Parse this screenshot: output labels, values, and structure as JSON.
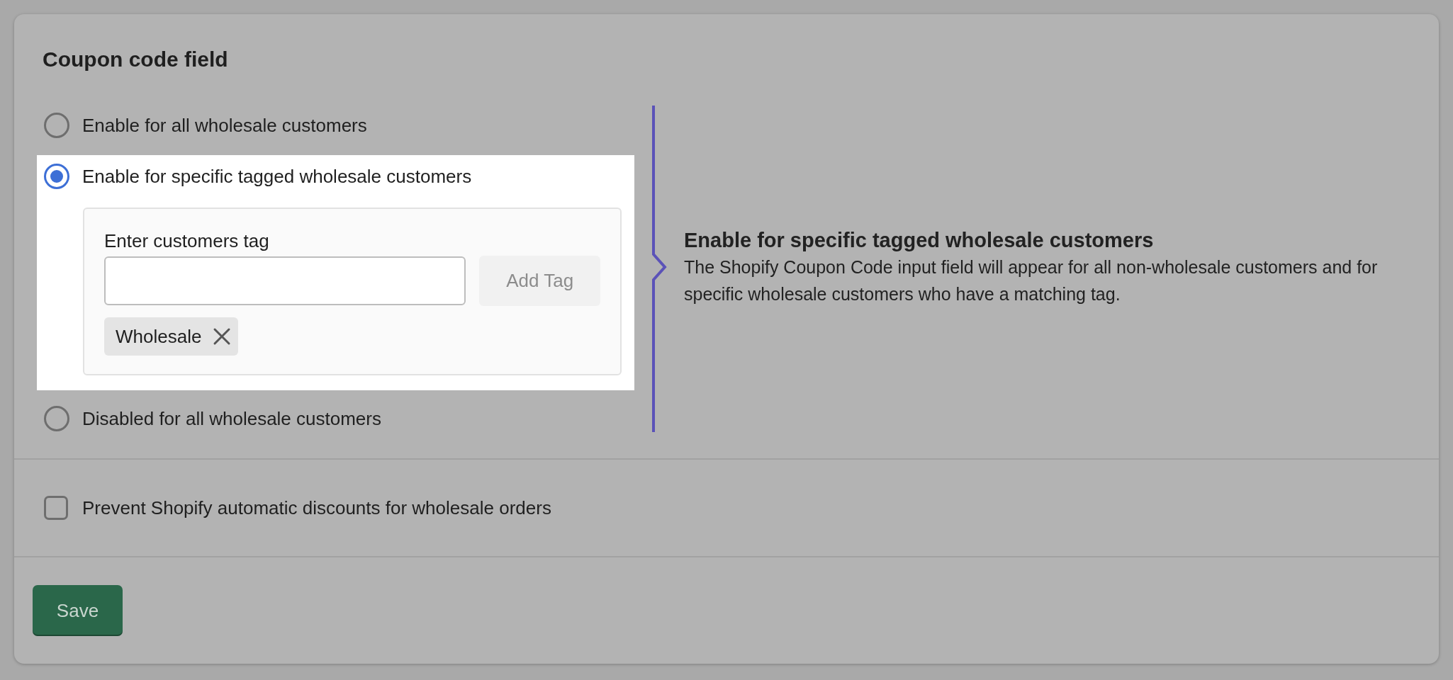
{
  "section": {
    "title": "Coupon code field"
  },
  "options": [
    {
      "label": "Enable for all wholesale customers",
      "selected": false
    },
    {
      "label": "Enable for specific tagged wholesale customers",
      "selected": true,
      "tag_panel": {
        "label": "Enter customers tag",
        "button": "Add Tag",
        "button_disabled": true,
        "tags": [
          {
            "label": "Wholesale"
          }
        ]
      }
    },
    {
      "label": "Disabled for all wholesale customers",
      "selected": false
    }
  ],
  "info": {
    "heading": "Enable for specific tagged wholesale customers",
    "text": "The Shopify Coupon Code input field will appear for all non-wholesale customers and for specific wholesale customers who have a matching tag."
  },
  "checkbox": {
    "label": "Prevent Shopify automatic discounts for wholesale orders",
    "checked": false
  },
  "save_button": "Save"
}
